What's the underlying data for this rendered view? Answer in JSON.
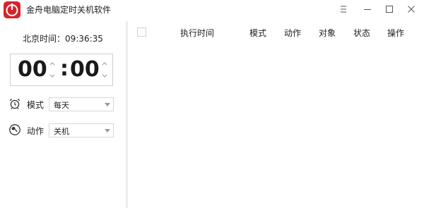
{
  "app": {
    "title": "金舟电脑定时关机软件"
  },
  "window_controls": [
    {
      "name": "pin-icon"
    },
    {
      "name": "minimize-icon"
    },
    {
      "name": "maximize-icon"
    },
    {
      "name": "close-icon"
    }
  ],
  "clock": {
    "text": "北京时间：09:36:35"
  },
  "timer": {
    "hours": "00",
    "separator": ":",
    "minutes": "00"
  },
  "mode": {
    "label": "模式",
    "value": "每天",
    "icon": "alarm-clock-icon"
  },
  "action": {
    "label": "动作",
    "value": "关机",
    "icon": "wrench-icon"
  },
  "table": {
    "columns": [
      "执行时间",
      "模式",
      "动作",
      "对象",
      "状态",
      "操作"
    ],
    "rows": []
  }
}
